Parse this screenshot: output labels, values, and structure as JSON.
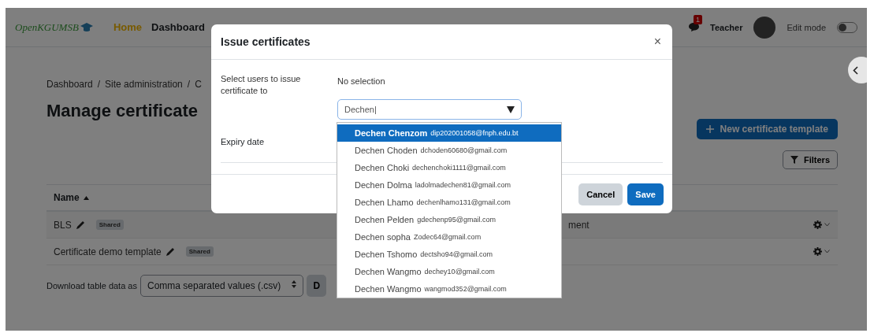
{
  "navbar": {
    "logo": "OpenKGUMSB",
    "nav_items": [
      {
        "label": "Home",
        "selected": true
      },
      {
        "label": "Dashboard",
        "selected": false
      }
    ],
    "notification_count": "1",
    "user": "Teacher",
    "edit_mode": {
      "label": "Edit mode",
      "on": false
    }
  },
  "page": {
    "breadcrumb": [
      "Dashboard",
      "Site administration",
      "C"
    ],
    "breadcrumb_separator": "/",
    "title": "Manage certificate",
    "new_button": "New certificate template",
    "filters_button": "Filters",
    "table": {
      "columns": [
        "Name"
      ],
      "rows": [
        {
          "name": "BLS",
          "badge": "Shared",
          "column_2": "ment"
        },
        {
          "name": "Certificate demo template",
          "badge": "Shared"
        }
      ]
    },
    "download": {
      "label": "Download table data as",
      "format": "Comma separated values (.csv)",
      "button": "D"
    }
  },
  "modal": {
    "title": "Issue certificates",
    "close": "×",
    "cursor": "|",
    "users_label": "Select users to issue certificate to",
    "selection": "No selection",
    "search_value": "Dechen",
    "expiry_label": "Expiry date",
    "options": [
      {
        "name": "Dechen Chenzom",
        "email": "dip202001058@fnph.edu.bt",
        "selected": true
      },
      {
        "name": "Dechen Choden",
        "email": "dchoden60680@gmail.com",
        "selected": false
      },
      {
        "name": "Dechen Choki",
        "email": "dechenchoki1111@gmail.com",
        "selected": false
      },
      {
        "name": "Dechen Dolma",
        "email": "ladolmadechen81@gmail.com",
        "selected": false
      },
      {
        "name": "Dechen Lhamo",
        "email": "dechenlhamo131@gmail.com",
        "selected": false
      },
      {
        "name": "Dechen Pelden",
        "email": "gdechenp95@gmail.com",
        "selected": false
      },
      {
        "name": "Dechen sopha",
        "email": "Zodec64@gmail.com",
        "selected": false
      },
      {
        "name": "Dechen Tshomo",
        "email": "dectsho94@gmail.com",
        "selected": false
      },
      {
        "name": "Dechen Wangmo",
        "email": "dechey10@gmail.com",
        "selected": false
      },
      {
        "name": "Dechen Wangmo",
        "email": "wangmod352@gmail.com",
        "selected": false
      }
    ],
    "cancel": "Cancel",
    "save": "Save"
  }
}
